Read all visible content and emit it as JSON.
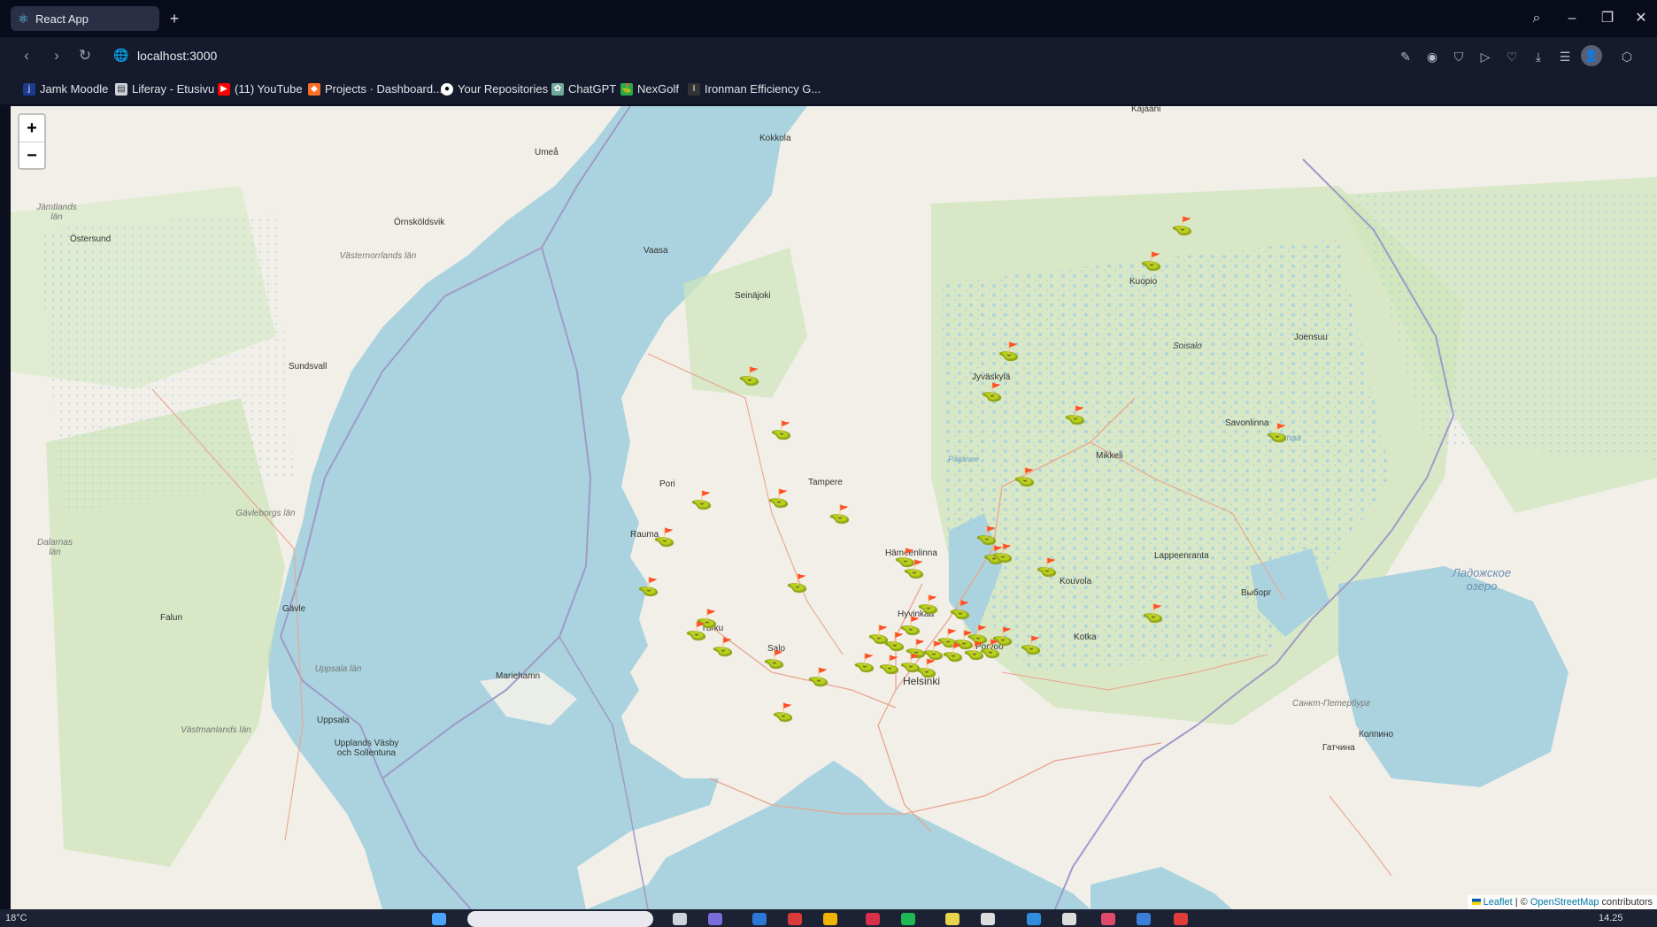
{
  "browser": {
    "tab_title": "React App",
    "new_tab": "+",
    "url": "localhost:3000",
    "window_controls": [
      "search-icon",
      "minimize-icon",
      "restore-icon",
      "close-icon"
    ]
  },
  "bookmarks": [
    {
      "label": "Jamk Moodle",
      "icon": "jamk-icon",
      "color": "#1b3b8c"
    },
    {
      "label": "Liferay - Etusivu",
      "icon": "document-icon",
      "color": "#cfd3dc"
    },
    {
      "label": "(11) YouTube",
      "icon": "youtube-icon",
      "color": "#ff0000"
    },
    {
      "label": "Projects · Dashboard...",
      "icon": "gitlab-icon",
      "color": "#fc6d26"
    },
    {
      "label": "Your Repositories",
      "icon": "github-icon",
      "color": "#ffffff"
    },
    {
      "label": "ChatGPT",
      "icon": "chatgpt-icon",
      "color": "#74aa9c"
    },
    {
      "label": "NexGolf",
      "icon": "nexgolf-icon",
      "color": "#2aa84a"
    },
    {
      "label": "Ironman Efficiency G...",
      "icon": "ironman-icon",
      "color": "#333333"
    }
  ],
  "map": {
    "zoom_in": "+",
    "zoom_out": "−",
    "attribution_leaflet": "Leaflet",
    "attribution_sep": " | © ",
    "attribution_osm": "OpenStreetMap",
    "attribution_tail": " contributors",
    "labels": {
      "kajaani": "Kajaani",
      "kokkola": "Kokkola",
      "umea": "Umeå",
      "jamtlands": "Jämtlands län",
      "ostersund": "Östersund",
      "ornskoldsvik": "Örnsköldsvik",
      "vasternorrlands": "Västernorrlands län",
      "vaasa": "Vaasa",
      "seinajoki": "Seinäjoki",
      "kuopio": "Kuopio",
      "soisalo": "Soisalo",
      "joensuu": "Joensuu",
      "sundsvall": "Sundsvall",
      "jyvaskyla": "Jyväskylä",
      "savonlinna": "Savonlinna",
      "saimaa": "Saimaa",
      "paijanne": "Päijänne",
      "mikkeli": "Mikkeli",
      "pori": "Pori",
      "tampere": "Tampere",
      "gavleborgs": "Gävleborgs län",
      "rauma": "Rauma",
      "hameenlinna": "Hämeenlinna",
      "lappeenranta": "Lappeenranta",
      "dalarnas": "Dalarnas län",
      "kouvola": "Kouvola",
      "ladoga": "Ладожское озеро",
      "vyborg": "Выборг",
      "falun": "Falun",
      "gavle": "Gävle",
      "hyvinkaa": "Hyvinkää",
      "turku": "Turku",
      "kotka": "Kotka",
      "salo": "Salo",
      "porvoo": "Porvoo",
      "mariehamn": "Mariehamn",
      "helsinki": "Helsinki",
      "uppsala_lan": "Uppsala län",
      "stpetersburg": "Санкт-Петербург",
      "uppsala": "Uppsala",
      "vastmanlands": "Västmanlands län",
      "upplands": "Upplands Väsby och Sollentuna",
      "kolpino": "Колпино",
      "gatchina": "Гатчина"
    }
  },
  "taskbar": {
    "temperature": "18°C",
    "time": "14.25"
  }
}
